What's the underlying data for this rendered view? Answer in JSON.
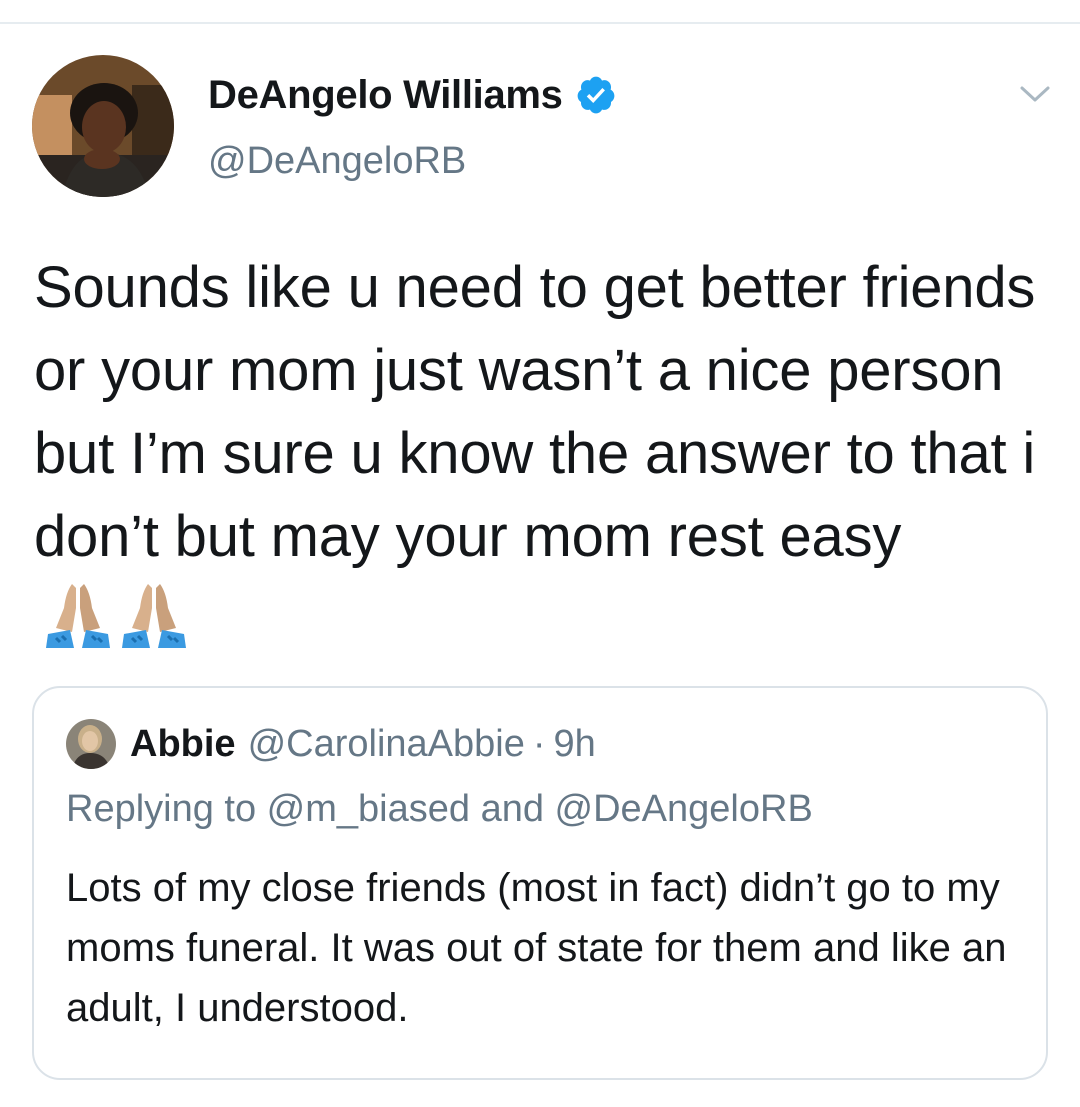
{
  "tweet": {
    "author": {
      "display_name": "DeAngelo Williams",
      "handle": "@DeAngeloRB",
      "verified": true,
      "avatar_icon": "profile-photo"
    },
    "menu_icon": "chevron-down-icon",
    "text": "Sounds like u need to get better friends or your mom just wasn’t a nice person but I’m sure u know the answer to that i don’t but may your mom rest easy",
    "emoji": [
      "folded-hands-icon",
      "folded-hands-icon"
    ]
  },
  "quoted_tweet": {
    "author": {
      "display_name": "Abbie",
      "handle": "@CarolinaAbbie",
      "avatar_icon": "profile-photo"
    },
    "separator": "·",
    "time": "9h",
    "replying_to": "Replying to @m_biased and @DeAngeloRB",
    "text": "Lots of my close friends (most in fact) didn’t go to my moms funeral. It was out of state for them and like an adult, I understood."
  },
  "colors": {
    "primary_text": "#14171a",
    "secondary_text": "#657786",
    "verified_blue": "#1da1f2",
    "border": "#dbe2e8"
  }
}
